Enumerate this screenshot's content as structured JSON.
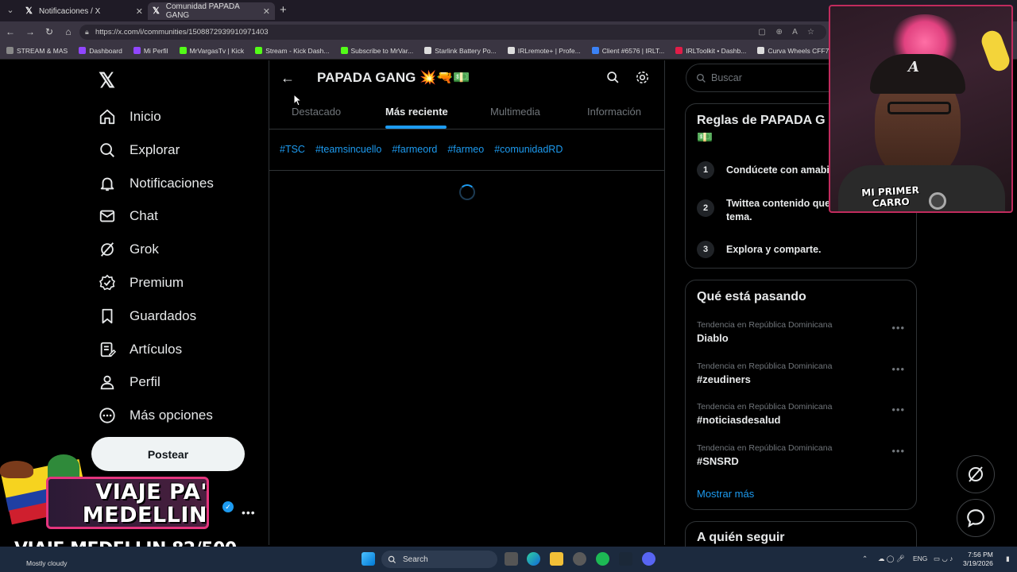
{
  "browser": {
    "tabs": [
      {
        "title": "Notificaciones / X",
        "active": false
      },
      {
        "title": "Comunidad PAPADA GANG",
        "active": true
      }
    ],
    "url": "https://x.com/i/communities/1508872939910971403",
    "bookmarks": [
      {
        "label": "STREAM & MAS",
        "color": "#888888"
      },
      {
        "label": "Dashboard",
        "color": "#9146ff"
      },
      {
        "label": "Mi Perfil",
        "color": "#9146ff"
      },
      {
        "label": "MrVargasTv | Kick",
        "color": "#53fc18"
      },
      {
        "label": "Stream - Kick Dash...",
        "color": "#53fc18"
      },
      {
        "label": "Subscribe to MrVar...",
        "color": "#53fc18"
      },
      {
        "label": "Starlink Battery Po...",
        "color": "#dddddd"
      },
      {
        "label": "IRLremote+ | Profe...",
        "color": "#dddddd"
      },
      {
        "label": "Client #6576 | IRLT...",
        "color": "#3b82f6"
      },
      {
        "label": "IRLToolkit • Dashb...",
        "color": "#e11d48"
      },
      {
        "label": "Curva Wheels CFF76",
        "color": "#dddddd"
      }
    ]
  },
  "nav": {
    "items": [
      {
        "label": "Inicio",
        "icon": "home-icon"
      },
      {
        "label": "Explorar",
        "icon": "search-icon"
      },
      {
        "label": "Notificaciones",
        "icon": "bell-icon"
      },
      {
        "label": "Chat",
        "icon": "mail-icon"
      },
      {
        "label": "Grok",
        "icon": "grok-icon"
      },
      {
        "label": "Premium",
        "icon": "verified-badge-icon"
      },
      {
        "label": "Guardados",
        "icon": "bookmark-icon"
      },
      {
        "label": "Artículos",
        "icon": "article-icon"
      },
      {
        "label": "Perfil",
        "icon": "person-icon"
      },
      {
        "label": "Más opciones",
        "icon": "more-circle-icon"
      }
    ],
    "post_label": "Postear"
  },
  "community": {
    "title": "PAPADA GANG 💥🔫💵",
    "tabs": [
      {
        "label": "Destacado",
        "active": false
      },
      {
        "label": "Más reciente",
        "active": true
      },
      {
        "label": "Multimedia",
        "active": false
      },
      {
        "label": "Información",
        "active": false
      }
    ],
    "hashtags": [
      "#TSC",
      "#teamsincuello",
      "#farmeord",
      "#farmeo",
      "#comunidadRD"
    ]
  },
  "sidebar": {
    "search_placeholder": "Buscar",
    "rules": {
      "title": "Reglas de PAPADA G",
      "title_emoji": "💵",
      "items": [
        {
          "num": "1",
          "text": "Condúcete con amabi"
        },
        {
          "num": "2",
          "text": "Twittea contenido que tema."
        },
        {
          "num": "3",
          "text": "Explora y comparte."
        }
      ]
    },
    "trends": {
      "title": "Qué está pasando",
      "items": [
        {
          "category": "Tendencia en República Dominicana",
          "name": "Diablo"
        },
        {
          "category": "Tendencia en República Dominicana",
          "name": "#zeudiners"
        },
        {
          "category": "Tendencia en República Dominicana",
          "name": "#noticiasdesalud"
        },
        {
          "category": "Tendencia en República Dominicana",
          "name": "#SNSRD"
        }
      ],
      "show_more": "Mostrar más"
    },
    "who_to_follow": {
      "title": "A quién seguir"
    }
  },
  "stream_overlay": {
    "webcam_label": "MI PRIMER CARRO",
    "promo_title": "VIAJE PA' MEDELLIN",
    "promo_count": "VIAJE MEDELLIN 82/500"
  },
  "taskbar": {
    "weather": "Mostly cloudy",
    "search_label": "Search",
    "language": "ENG",
    "time": "7:56 PM",
    "date": "3/19/2026"
  }
}
